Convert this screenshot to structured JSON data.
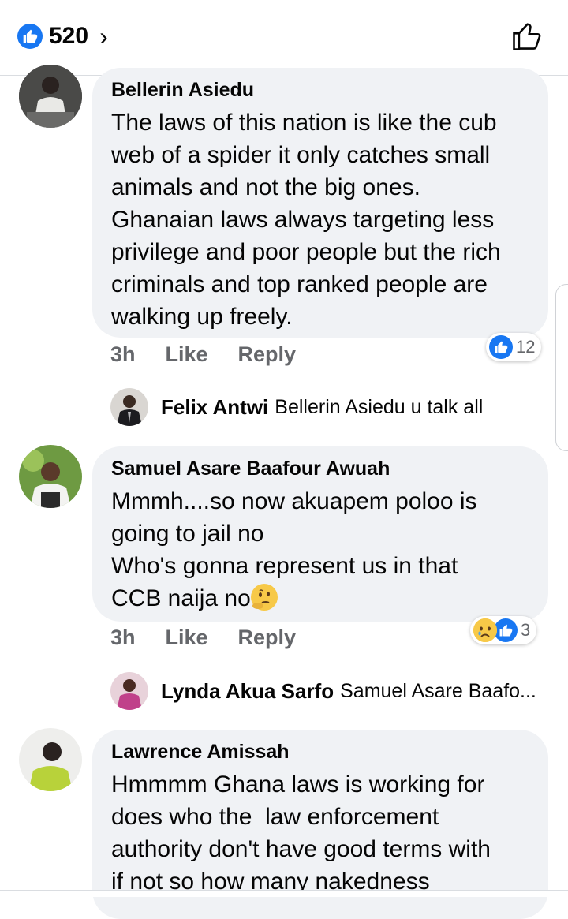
{
  "header": {
    "like_count": "520"
  },
  "comments": [
    {
      "author": "Bellerin Asiedu",
      "text": "The laws of this nation is like the cub\nweb of a spider it only catches small\nanimals and not the big ones.\nGhanaian laws always targeting less\nprivilege and poor people but the rich\ncriminals and top ranked people are\nwalking up freely.",
      "time": "3h",
      "like": "Like",
      "reply": "Reply",
      "reaction_count": "12",
      "reply_preview": {
        "name": "Felix Antwi",
        "snippet": "Bellerin Asiedu u talk all"
      }
    },
    {
      "author": "Samuel Asare Baafour Awuah",
      "text": "Mmmh....so now akuapem poloo is\ngoing to jail no\nWho's gonna represent us in that\nCCB naija no",
      "time": "3h",
      "like": "Like",
      "reply": "Reply",
      "reaction_count": "3",
      "reply_preview": {
        "name": "Lynda Akua Sarfo",
        "snippet": "Samuel Asare Baafo..."
      }
    },
    {
      "author": "Lawrence Amissah",
      "text": "Hmmmm Ghana laws is working for\ndoes who the  law enforcement\nauthority don't have good terms with\nif not so how many nakedness"
    }
  ],
  "colors": {
    "accent": "#1877f2",
    "bubble": "#f0f2f5",
    "meta": "#65676b"
  }
}
